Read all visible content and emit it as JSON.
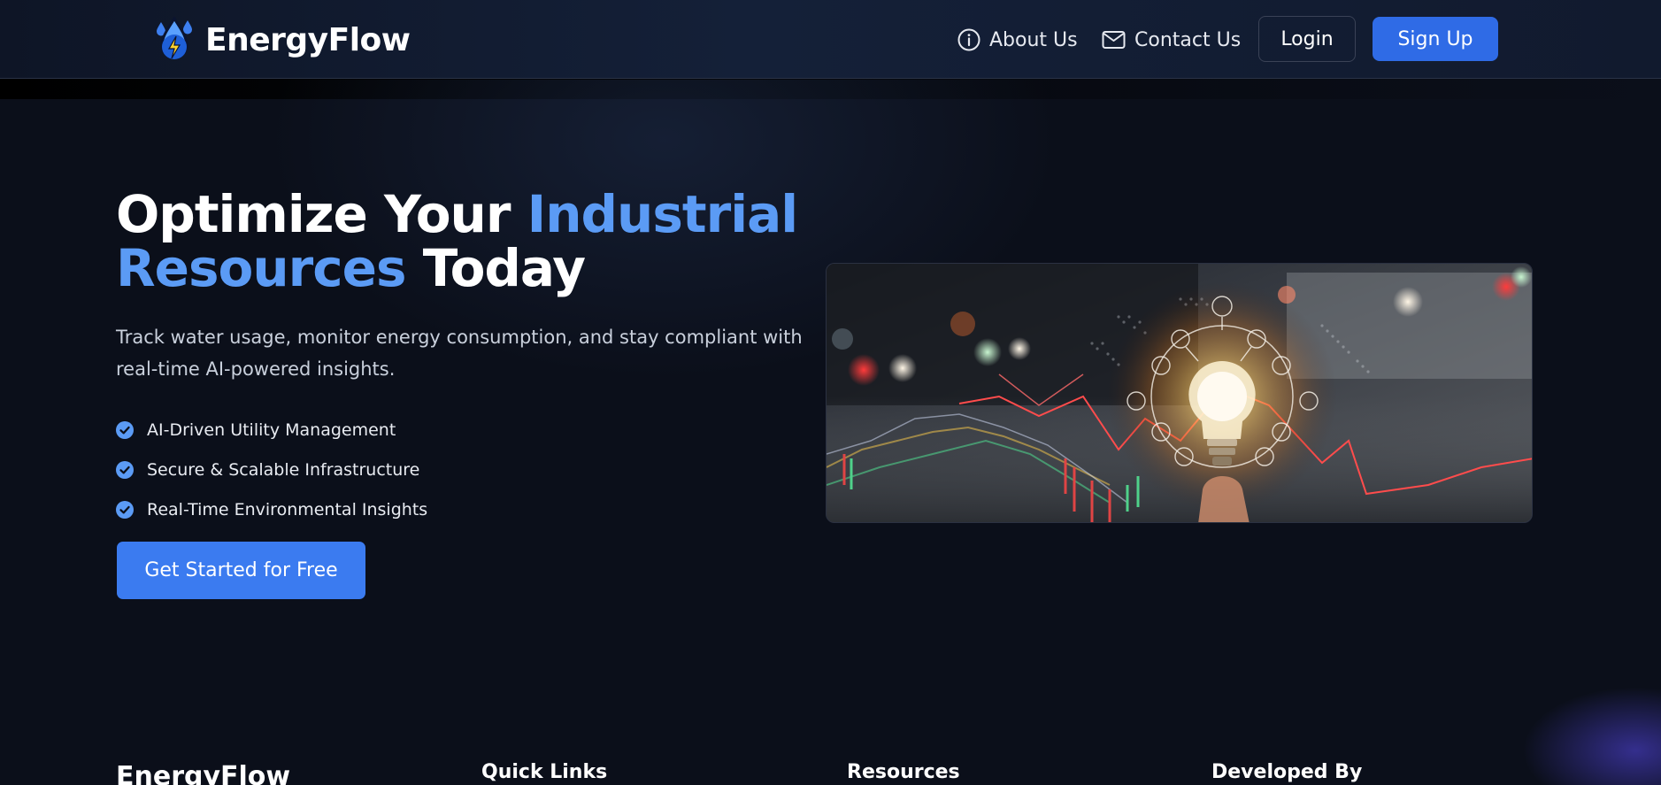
{
  "header": {
    "brand": "EnergyFlow",
    "nav": {
      "about": "About Us",
      "contact": "Contact Us"
    },
    "login_label": "Login",
    "signup_label": "Sign Up"
  },
  "hero": {
    "headline_part1": "Optimize Your ",
    "headline_accent1": "Industrial",
    "headline_accent2": "Resources",
    "headline_part2": " Today",
    "subtitle": "Track water usage, monitor energy consumption, and stay compliant with real-time AI-powered insights.",
    "features": [
      "AI-Driven Utility Management",
      "Secure & Scalable Infrastructure",
      "Real-Time Environmental Insights"
    ],
    "cta_label": "Get Started for Free"
  },
  "footer": {
    "brand": "EnergyFlow",
    "columns": [
      "Quick Links",
      "Resources",
      "Developed By"
    ]
  },
  "colors": {
    "accent": "#5b9bf5",
    "primary_button": "#2f6be6",
    "cta_button": "#3b7bf0",
    "background": "#0b0f1a"
  },
  "icons": {
    "logo": "water-drops-lightning-icon",
    "about": "info-circle-icon",
    "contact": "envelope-icon",
    "feature": "check-circle-icon"
  }
}
